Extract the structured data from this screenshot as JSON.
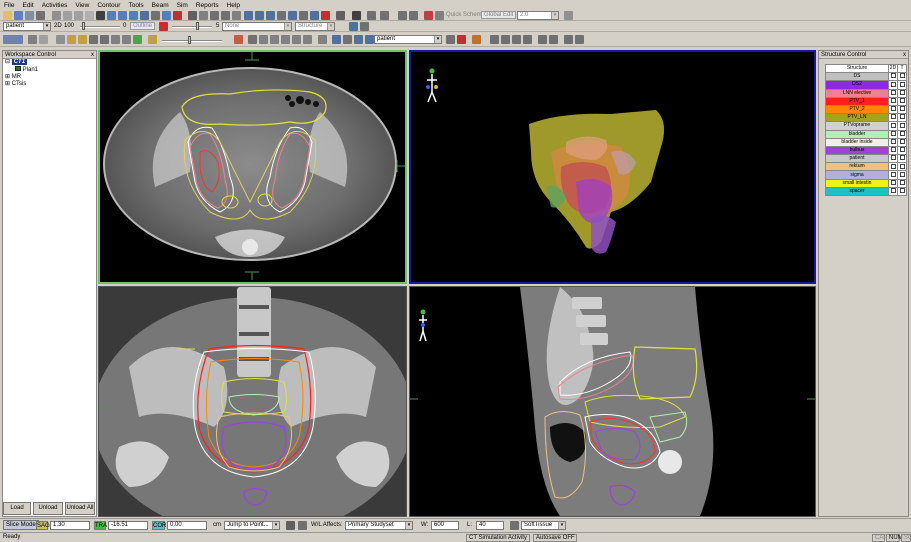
{
  "menu": [
    "File",
    "Edit",
    "Activities",
    "View",
    "Contour",
    "Tools",
    "Beam",
    "Sim",
    "Reports",
    "Help"
  ],
  "toolbar": {
    "quick_scheme": "Quick Scheme",
    "global_edit": "Global Edit",
    "zoom_value": "2.0",
    "patient_select": "patient",
    "mode_2d": "2D",
    "size_value": "100",
    "outline_btn": "Outline",
    "value_0": "0",
    "value_5": "5",
    "none_select": "None",
    "structure_select": "Structure",
    "patient_select_2": "patient"
  },
  "workspace": {
    "title": "Workspace Control",
    "close": "x",
    "tree": [
      {
        "label": "CT1",
        "level": 0
      },
      {
        "label": "Plan1",
        "level": 1
      },
      {
        "label": "MR",
        "level": 0
      },
      {
        "label": "CTsis",
        "level": 0
      }
    ],
    "buttons": [
      "Load",
      "Unload",
      "Unload All"
    ]
  },
  "structure_panel": {
    "title": "Structure Control",
    "pin": "x",
    "col_structure": "Structure",
    "col_2d": "2D",
    "col_t": "T",
    "rows": [
      {
        "name": "DS",
        "color": "#c0c0c0"
      },
      {
        "name": "DS2",
        "color": "#8a2be2"
      },
      {
        "name": "LNN elective",
        "color": "#f08090"
      },
      {
        "name": "PTV_1",
        "color": "#ff2020"
      },
      {
        "name": "PTV_2",
        "color": "#ff8800"
      },
      {
        "name": "PTV_LN",
        "color": "#a8a020"
      },
      {
        "name": "PTVoprame",
        "color": "#d0d0d0"
      },
      {
        "name": "bladder",
        "color": "#b0f0b0"
      },
      {
        "name": "bladder inside",
        "color": "#f0f0f0"
      },
      {
        "name": "bulbus",
        "color": "#a040e0"
      },
      {
        "name": "patient",
        "color": "#c8c8c8"
      },
      {
        "name": "rektum",
        "color": "#f0c080"
      },
      {
        "name": "sigma",
        "color": "#b0b0e0"
      },
      {
        "name": "small intestin",
        "color": "#f0f020"
      },
      {
        "name": "spacer",
        "color": "#20c0c0"
      }
    ]
  },
  "bottom": {
    "slice_mode": "Slice Mode",
    "sag": "SAG",
    "sag_value": "1.30",
    "tra": "TRA",
    "tra_value": "-16.51",
    "cor": "COR",
    "cor_value": "0.00",
    "unit": "cm",
    "jump_to": "Jump to Point...",
    "wl_affects": "W/L Affects:",
    "wl_select": "Primary Studyset",
    "w_label": "W:",
    "w_value": "600",
    "l_label": "L:",
    "l_value": "40",
    "preset": "SoftTissue"
  },
  "status": {
    "ready": "Ready",
    "activity": "CT Simulation Activity",
    "autosave": "Autosave OFF",
    "cap": "CAP",
    "num": "NUM",
    "scrl": "SCRL"
  },
  "colors": {
    "active_border": "#1a1aa0",
    "view_border": "#6fbf6f"
  }
}
